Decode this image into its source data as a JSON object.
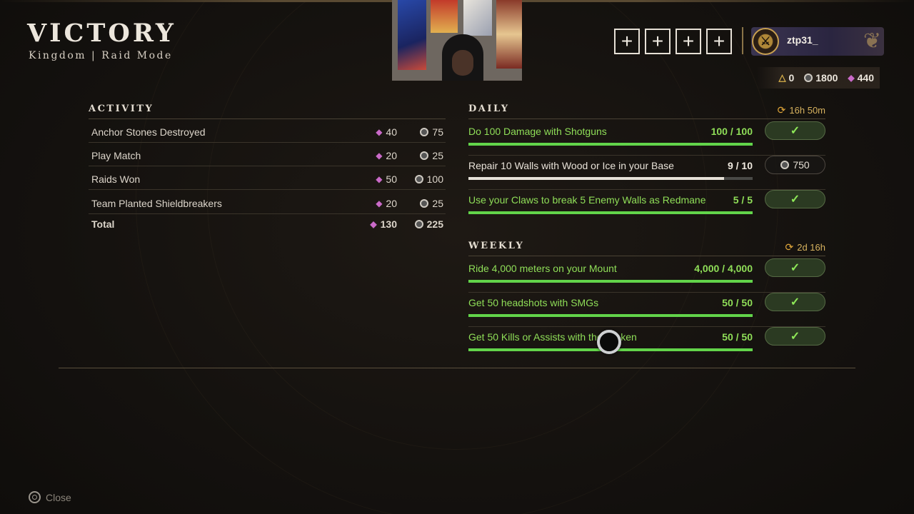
{
  "header": {
    "title": "VICTORY",
    "subtitle": "Kingdom | Raid Mode"
  },
  "party": {
    "slots": [
      "+",
      "+",
      "+",
      "+"
    ]
  },
  "profile": {
    "username": "ztp31_"
  },
  "currency": {
    "triangle": "0",
    "coins": "1800",
    "gems": "440"
  },
  "activity": {
    "heading": "ACTIVITY",
    "rows": [
      {
        "name": "Anchor Stones Destroyed",
        "gems": "40",
        "coins": "75"
      },
      {
        "name": "Play Match",
        "gems": "20",
        "coins": "25"
      },
      {
        "name": "Raids Won",
        "gems": "50",
        "coins": "100"
      },
      {
        "name": "Team Planted Shieldbreakers",
        "gems": "20",
        "coins": "25"
      }
    ],
    "total": {
      "name": "Total",
      "gems": "130",
      "coins": "225"
    }
  },
  "daily": {
    "heading": "DAILY",
    "timer": "16h 50m",
    "challenges": [
      {
        "label": "Do 100 Damage with Shotguns",
        "progress": "100 / 100",
        "fill": 1.0,
        "status": "complete",
        "reward": "✓"
      },
      {
        "label": "Repair 10 Walls with Wood or Ice in your Base",
        "progress": "9 / 10",
        "fill": 0.9,
        "status": "in-progress",
        "reward": "750"
      },
      {
        "label": "Use your Claws to break 5 Enemy Walls as Redmane",
        "progress": "5 / 5",
        "fill": 1.0,
        "status": "complete",
        "reward": "✓"
      }
    ]
  },
  "weekly": {
    "heading": "WEEKLY",
    "timer": "2d 16h",
    "challenges": [
      {
        "label": "Ride 4,000 meters on your Mount",
        "progress": "4,000 / 4,000",
        "fill": 1.0,
        "status": "complete",
        "reward": "✓"
      },
      {
        "label": "Get 50 headshots with SMGs",
        "progress": "50 / 50",
        "fill": 1.0,
        "status": "complete",
        "reward": "✓"
      },
      {
        "label": "Get 50 Kills or Assists with the Kraken",
        "progress": "50 / 50",
        "fill": 1.0,
        "status": "complete",
        "reward": "✓"
      }
    ]
  },
  "footer": {
    "close_label": "Close"
  },
  "colors": {
    "accent_green": "#62d44a",
    "gold": "#d7b25e",
    "gem_pink": "#c96ac8"
  }
}
